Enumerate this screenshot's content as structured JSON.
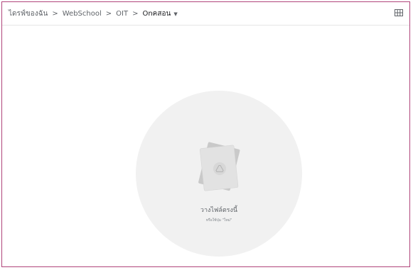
{
  "breadcrumb": {
    "items": [
      {
        "label": "ไดรฟ์ของฉัน"
      },
      {
        "label": "WebSchool"
      },
      {
        "label": "OIT"
      },
      {
        "label": "Onคสอน"
      }
    ],
    "separator": ">"
  },
  "header": {
    "view_toggle_icon": "grid-view-icon"
  },
  "empty_state": {
    "title": "วางไฟล์ตรงนี้",
    "subtitle": "หรือใช้ปุ่ม \"ใหม่\"",
    "illustration_icon": "drive-logo-icon"
  },
  "colors": {
    "frame_border": "#b0447a",
    "drop_zone": "#f1f1f1",
    "text_primary": "#202124",
    "text_secondary": "#5f6368"
  }
}
